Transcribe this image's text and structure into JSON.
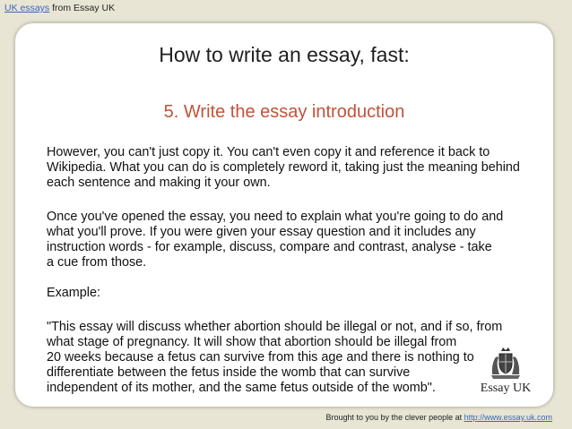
{
  "header": {
    "link_text": "UK essays",
    "suffix_text": " from Essay UK"
  },
  "slide": {
    "title": "How to write an essay, fast:",
    "subtitle": "5. Write the essay introduction",
    "paragraph1": [
      "However, you can't just copy it.  You can't even copy it and reference it back to",
      "Wikipedia.  What you can do is completely reword it, taking just the meaning behind",
      "each sentence and making it your own."
    ],
    "paragraph2": [
      "Once you've opened the essay, you need to explain what you're going to do and",
      "what you'll prove.  If you were given your essay question and it includes any",
      "instruction words - for example, discuss, compare and contrast, analyse - take",
      "a cue from those."
    ],
    "example_label": "Example:",
    "paragraph3": [
      "\"This essay will discuss whether abortion should be illegal or not, and if so, from",
      "what stage of pregnancy.  It will show that abortion should be illegal from",
      "20 weeks because a fetus can survive from this age and there is nothing to",
      "differentiate between the fetus inside the womb that can survive",
      "independent of its mother, and the same fetus outside of the womb\"."
    ],
    "logo_text": "Essay UK",
    "logo_icon": "coat-of-arms-icon"
  },
  "footer": {
    "prefix_text": "Brought to you by the clever people at ",
    "link_text": "http://www.essay.uk.com"
  }
}
